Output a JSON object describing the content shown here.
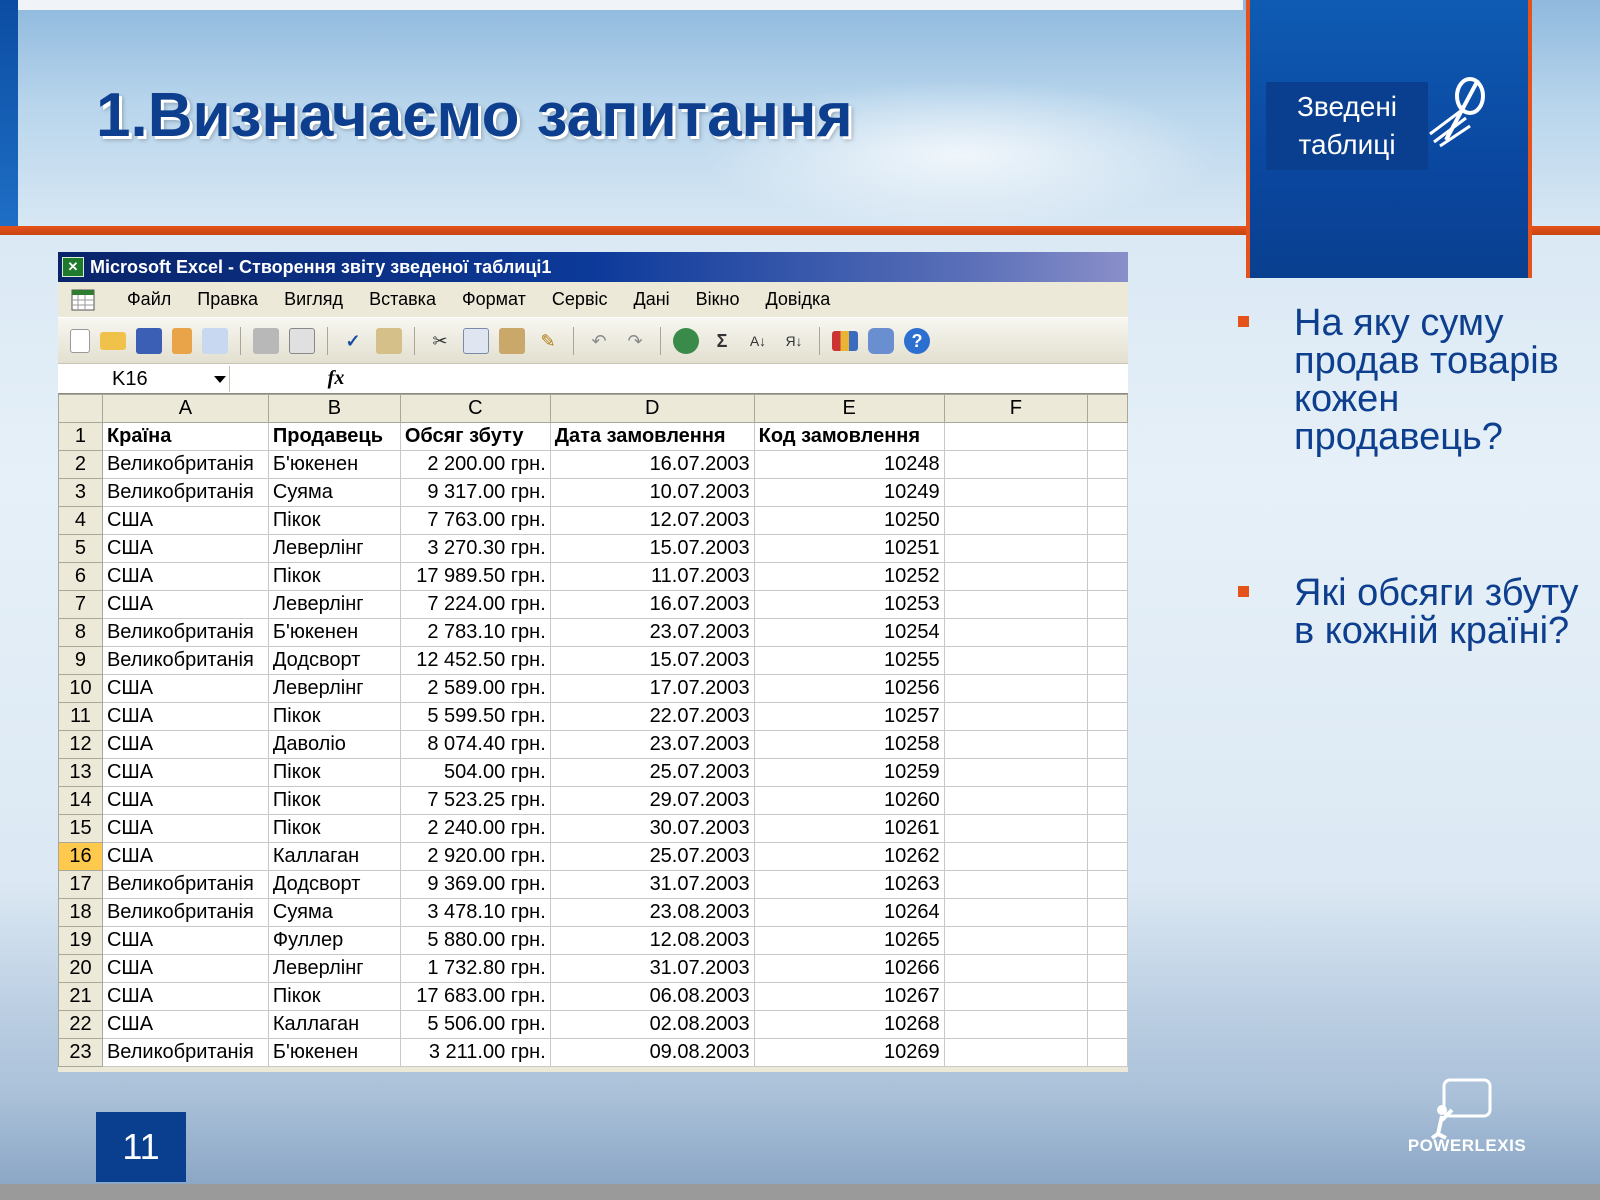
{
  "slide": {
    "title": "1.Визначаємо запитання",
    "section_label": "Зведені таблиці",
    "page_number": "11",
    "brand": "POWERLEXIS",
    "bullets": [
      "На яку суму продав товарів кожен продавець?",
      "Які обсяги збуту в кожній країні?"
    ]
  },
  "excel": {
    "window_title": "Microsoft Excel - Створення звіту зведеної таблиці1",
    "menu": [
      "Файл",
      "Правка",
      "Вигляд",
      "Вставка",
      "Формат",
      "Сервіс",
      "Дані",
      "Вікно",
      "Довідка"
    ],
    "name_box": "K16",
    "fx_label": "fx",
    "selected_row": "16",
    "column_headers": [
      "A",
      "B",
      "C",
      "D",
      "E",
      "F"
    ],
    "table_header": [
      "Країна",
      "Продавець",
      "Обсяг збуту",
      "Дата замовлення",
      "Код замовлення"
    ],
    "rows": [
      [
        "2",
        "Великобританія",
        "Б'юкенен",
        "2 200.00 грн.",
        "16.07.2003",
        "10248"
      ],
      [
        "3",
        "Великобританія",
        "Суяма",
        "9 317.00 грн.",
        "10.07.2003",
        "10249"
      ],
      [
        "4",
        "США",
        "Пікок",
        "7 763.00 грн.",
        "12.07.2003",
        "10250"
      ],
      [
        "5",
        "США",
        "Леверлінг",
        "3 270.30 грн.",
        "15.07.2003",
        "10251"
      ],
      [
        "6",
        "США",
        "Пікок",
        "17 989.50 грн.",
        "11.07.2003",
        "10252"
      ],
      [
        "7",
        "США",
        "Леверлінг",
        "7 224.00 грн.",
        "16.07.2003",
        "10253"
      ],
      [
        "8",
        "Великобританія",
        "Б'юкенен",
        "2 783.10 грн.",
        "23.07.2003",
        "10254"
      ],
      [
        "9",
        "Великобританія",
        "Додсворт",
        "12 452.50 грн.",
        "15.07.2003",
        "10255"
      ],
      [
        "10",
        "США",
        "Леверлінг",
        "2 589.00 грн.",
        "17.07.2003",
        "10256"
      ],
      [
        "11",
        "США",
        "Пікок",
        "5 599.50 грн.",
        "22.07.2003",
        "10257"
      ],
      [
        "12",
        "США",
        "Даволіо",
        "8 074.40 грн.",
        "23.07.2003",
        "10258"
      ],
      [
        "13",
        "США",
        "Пікок",
        "504.00 грн.",
        "25.07.2003",
        "10259"
      ],
      [
        "14",
        "США",
        "Пікок",
        "7 523.25 грн.",
        "29.07.2003",
        "10260"
      ],
      [
        "15",
        "США",
        "Пікок",
        "2 240.00 грн.",
        "30.07.2003",
        "10261"
      ],
      [
        "16",
        "США",
        "Каллаган",
        "2 920.00 грн.",
        "25.07.2003",
        "10262"
      ],
      [
        "17",
        "Великобританія",
        "Додсворт",
        "9 369.00 грн.",
        "31.07.2003",
        "10263"
      ],
      [
        "18",
        "Великобританія",
        "Суяма",
        "3 478.10 грн.",
        "23.08.2003",
        "10264"
      ],
      [
        "19",
        "США",
        "Фуллер",
        "5 880.00 грн.",
        "12.08.2003",
        "10265"
      ],
      [
        "20",
        "США",
        "Леверлінг",
        "1 732.80 грн.",
        "31.07.2003",
        "10266"
      ],
      [
        "21",
        "США",
        "Пікок",
        "17 683.00 грн.",
        "06.08.2003",
        "10267"
      ],
      [
        "22",
        "США",
        "Каллаган",
        "5 506.00 грн.",
        "02.08.2003",
        "10268"
      ],
      [
        "23",
        "Великобританія",
        "Б'юкенен",
        "3 211.00 грн.",
        "09.08.2003",
        "10269"
      ]
    ]
  },
  "colors": {
    "title_blue": "#0d3f8e",
    "accent_orange": "#e5531a",
    "box_blue": "#0a3f8f"
  }
}
